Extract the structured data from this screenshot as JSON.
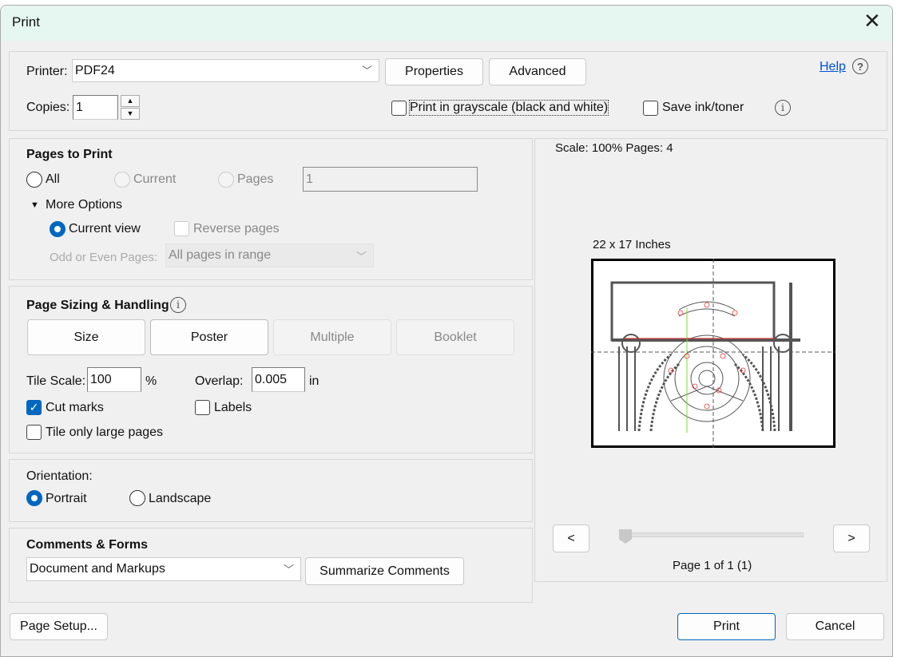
{
  "window": {
    "title": "Print",
    "close_icon": "close-icon"
  },
  "printer": {
    "label": "Printer:",
    "value": "PDF24",
    "properties": "Properties",
    "advanced": "Advanced",
    "help": "Help"
  },
  "copies": {
    "label": "Copies:",
    "value": "1"
  },
  "options": {
    "grayscale": "Print in grayscale (black and white)",
    "grayscale_checked": false,
    "save_ink": "Save ink/toner",
    "save_ink_checked": false
  },
  "pages_to_print": {
    "title": "Pages to Print",
    "all": "All",
    "current": "Current",
    "pages": "Pages",
    "pages_value": "1",
    "selected": "All",
    "more_options": "More Options",
    "current_view": "Current view",
    "reverse_pages": "Reverse pages",
    "odd_even_label": "Odd or Even Pages:",
    "odd_even_value": "All pages in range"
  },
  "page_sizing": {
    "title": "Page Sizing & Handling",
    "tabs": [
      "Size",
      "Poster",
      "Multiple",
      "Booklet"
    ],
    "selected_tab": "Poster",
    "tile_scale_label": "Tile Scale:",
    "tile_scale_value": "100",
    "tile_scale_unit": "%",
    "overlap_label": "Overlap:",
    "overlap_value": "0.005",
    "overlap_unit": "in",
    "cut_marks": "Cut marks",
    "cut_marks_checked": true,
    "labels": "Labels",
    "labels_checked": false,
    "tile_large": "Tile only large pages",
    "tile_large_checked": false
  },
  "orientation": {
    "title": "Orientation:",
    "portrait": "Portrait",
    "landscape": "Landscape",
    "selected": "Portrait"
  },
  "comments": {
    "title": "Comments & Forms",
    "value": "Document and Markups",
    "summarize": "Summarize Comments"
  },
  "preview": {
    "scale_info": "Scale: 100% Pages: 4",
    "paper_size": "22 x 17 Inches",
    "prev": "<",
    "next": ">",
    "page_info": "Page 1 of 1 (1)",
    "slider_position": 0
  },
  "footer": {
    "page_setup": "Page Setup...",
    "print": "Print",
    "cancel": "Cancel"
  },
  "colors": {
    "accent": "#0067c0",
    "titlebar": "#e6f6f1",
    "link": "#0050d8"
  }
}
